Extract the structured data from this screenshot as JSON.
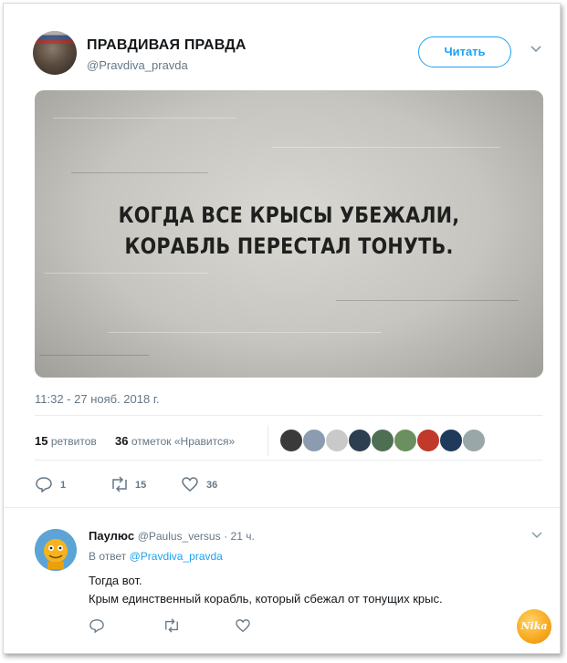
{
  "tweet": {
    "display_name": "ПРАВДИВАЯ ПРАВДА",
    "handle": "@Pravdiva_pravda",
    "follow_label": "Читать",
    "image_text_line1": "КОГДА ВСЕ КРЫСЫ УБЕЖАЛИ,",
    "image_text_line2": "КОРАБЛЬ ПЕРЕСТАЛ ТОНУТЬ.",
    "timestamp": "11:32 - 27 нояб. 2018 г.",
    "retweets_count": "15",
    "retweets_label": "ретвитов",
    "likes_count": "36",
    "likes_label": "отметок «Нравится»",
    "liker_colors": [
      "#3a3a3a",
      "#8b9bb0",
      "#c9c9c9",
      "#2c3e50",
      "#4f6f52",
      "#6b8f5e",
      "#c0392b",
      "#1f3a5a",
      "#9aa7a8"
    ],
    "actions": {
      "reply_count": "1",
      "retweet_count": "15",
      "like_count": "36"
    }
  },
  "reply": {
    "name": "Паулюс",
    "handle": "@Paulus_versus",
    "time": "· 21 ч.",
    "in_reply_prefix": "В ответ",
    "in_reply_mention": "@Pravdiva_pravda",
    "text_line1": "Тогда вот.",
    "text_line2": "Крым единственный корабль, который сбежал от тонущих крыс."
  },
  "watermark": "Nika",
  "colors": {
    "accent": "#1da1f2",
    "secondary_text": "#657786",
    "primary_text": "#14171a"
  }
}
